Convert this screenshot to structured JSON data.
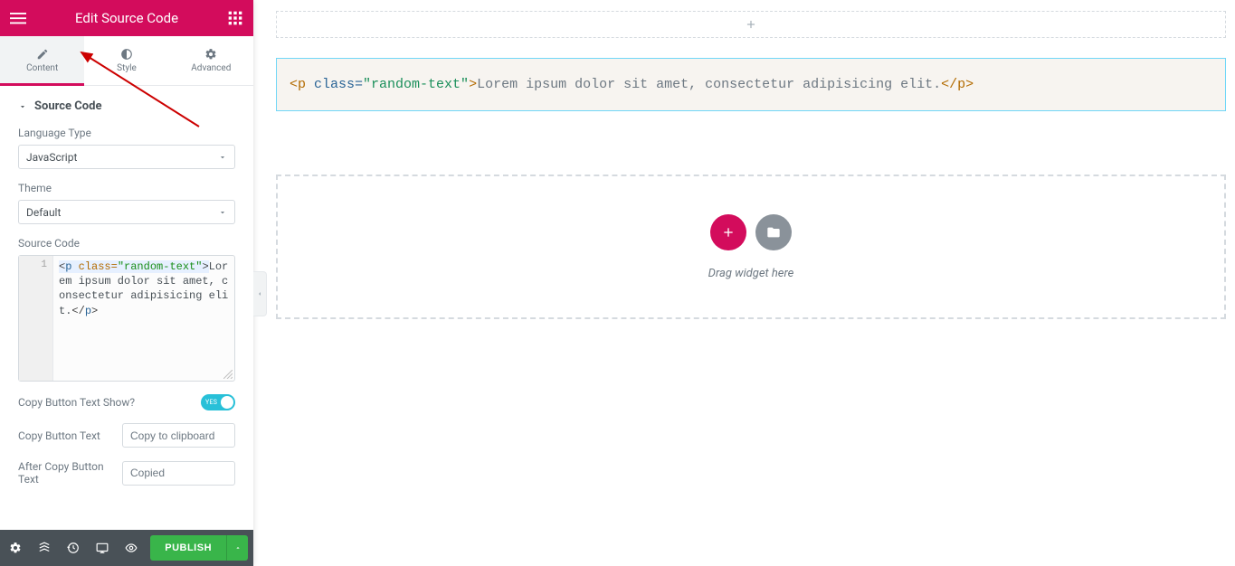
{
  "panel": {
    "title": "Edit Source Code",
    "tabs": {
      "content": "Content",
      "style": "Style",
      "advanced": "Advanced"
    },
    "section_title": "Source Code",
    "language_label": "Language Type",
    "language_value": "JavaScript",
    "theme_label": "Theme",
    "theme_value": "Default",
    "source_code_label": "Source Code",
    "line_number": "1",
    "code_parts": {
      "open_br": "<",
      "tag": "p",
      "space": " ",
      "attr": "class=",
      "str": "\"random-text\"",
      "close_br": ">",
      "text": "Lorem ipsum dolor sit amet, consectetur adipisicing elit.",
      "end_open": "</",
      "end_close": ">"
    },
    "copy_show_label": "Copy Button Text Show?",
    "copy_show_value": "YES",
    "copy_btn_label": "Copy Button Text",
    "copy_btn_value": "Copy to clipboard",
    "after_copy_label": "After Copy Button Text",
    "after_copy_value": "Copied",
    "publish": "PUBLISH"
  },
  "preview": {
    "code_parts": {
      "open": "<p ",
      "class_kw": "class=",
      "class_val": "\"random-text\"",
      "close": ">",
      "text": "Lorem ipsum dolor sit amet, consectetur adipisicing elit.",
      "end": "</p>"
    },
    "drop_text": "Drag widget here"
  }
}
